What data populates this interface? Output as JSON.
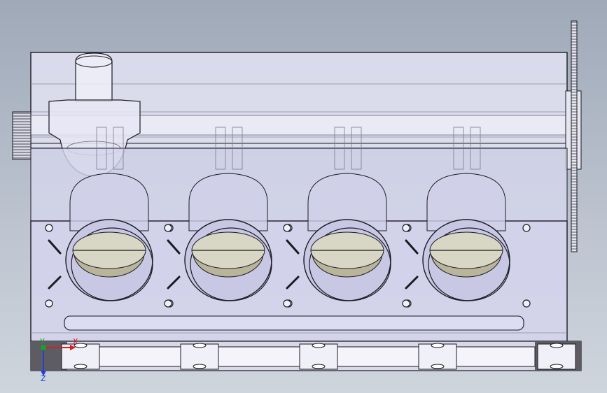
{
  "model": {
    "view": "front",
    "cylinders": 4,
    "display_mode": "transparent-shaded"
  },
  "triad": {
    "x_label": "X",
    "y_label": "Y",
    "z_label": "Z",
    "x_color": "#e0191c",
    "y_color": "#18a02a",
    "z_color": "#2040d8"
  },
  "colors": {
    "background_top": "#9fa9b8",
    "background_bottom": "#cfd5dd",
    "block_fill": "#dcdcf0",
    "edge": "#1a1a22",
    "piston_fill": "#b9b59a",
    "base_fill": "#5a5a60"
  }
}
